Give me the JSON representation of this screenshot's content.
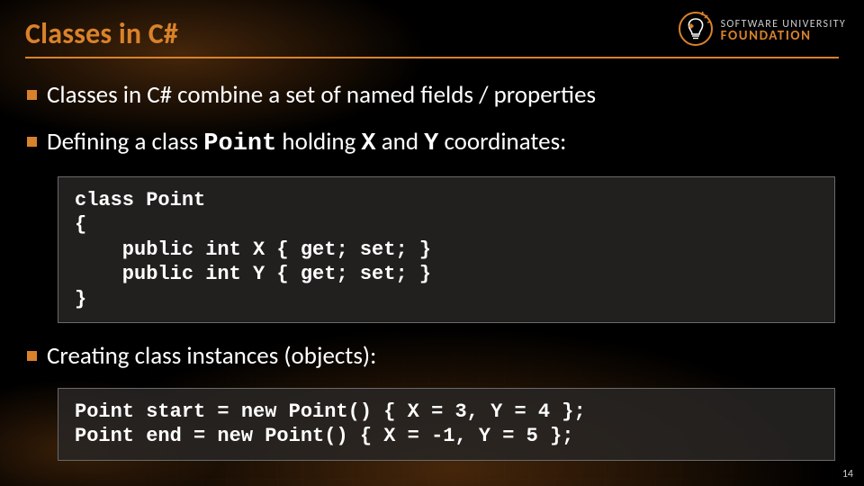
{
  "logo": {
    "line1": "SOFTWARE UNIVERSITY",
    "line2": "FOUNDATION"
  },
  "title": "Classes in C#",
  "bullets": [
    {
      "segments": [
        {
          "text": "Classes in C# combine a set of named fields / properties",
          "mono": false
        }
      ]
    },
    {
      "segments": [
        {
          "text": "Defining a class ",
          "mono": false
        },
        {
          "text": "Point",
          "mono": true
        },
        {
          "text": " holding ",
          "mono": false
        },
        {
          "text": "X",
          "mono": true
        },
        {
          "text": " and ",
          "mono": false
        },
        {
          "text": "Y",
          "mono": true
        },
        {
          "text": " coordinates:",
          "mono": false
        }
      ]
    }
  ],
  "code1": "class Point\n{\n    public int X { get; set; }\n    public int Y { get; set; }\n}",
  "bullet3": {
    "segments": [
      {
        "text": "Creating class instances (objects):",
        "mono": false
      }
    ]
  },
  "code2": "Point start = new Point() { X = 3, Y = 4 };\nPoint end = new Point() { X = -1, Y = 5 };",
  "page_number": "14",
  "accent_color": "#d9822b"
}
